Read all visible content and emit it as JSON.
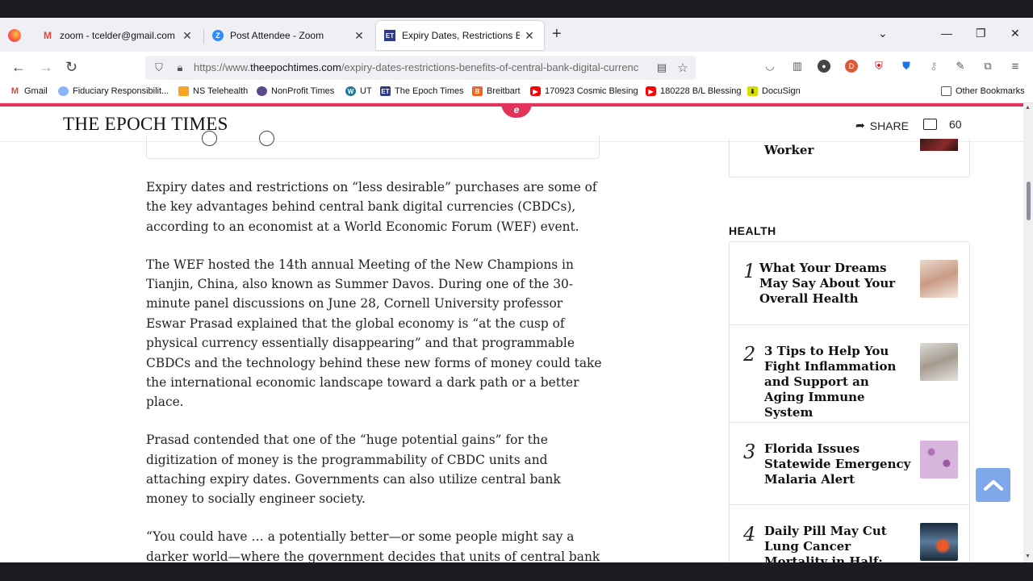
{
  "browser": {
    "tabs": [
      {
        "title": "zoom - tcelder@gmail.com - G",
        "icon": "gmail-icon",
        "active": false
      },
      {
        "title": "Post Attendee - Zoom",
        "icon": "zoom-icon",
        "active": false
      },
      {
        "title": "Expiry Dates, Restrictions Benef",
        "icon": "epoch-times-icon",
        "active": true
      }
    ],
    "new_tab": "+",
    "url_prefix": "https://www.",
    "url_domain": "theepochtimes.com",
    "url_path": "/expiry-dates-restrictions-benefits-of-central-bank-digital-currenc",
    "bookmarks": [
      {
        "label": "Gmail",
        "icon": "gmail-icon",
        "color": "#ea4335"
      },
      {
        "label": "Fiduciary Responsibilit...",
        "icon": "cloud-icon",
        "color": "#8ab4f8"
      },
      {
        "label": "NS Telehealth",
        "icon": "folder-icon",
        "color": "#f5a623"
      },
      {
        "label": "NonProfit Times",
        "icon": "globe-icon",
        "color": "#5b4a8a"
      },
      {
        "label": "UT",
        "icon": "wordpress-icon",
        "color": "#21759b"
      },
      {
        "label": "The Epoch Times",
        "icon": "epoch-times-icon",
        "color": "#2e3b8c"
      },
      {
        "label": "Breitbart",
        "icon": "breitbart-icon",
        "color": "#f26522"
      },
      {
        "label": "170923 Cosmic Blesing",
        "icon": "youtube-icon",
        "color": "#ff0000"
      },
      {
        "label": "180228 B/L Blessing",
        "icon": "youtube-icon",
        "color": "#ff0000"
      },
      {
        "label": "DocuSign",
        "icon": "docusign-icon",
        "color": "#d5e000"
      }
    ],
    "other_bookmarks": "Other Bookmarks"
  },
  "site": {
    "logo": "THE EPOCH TIMES",
    "share_label": "SHARE",
    "comment_count": "60",
    "accent_color": "#e3335b"
  },
  "article": {
    "paragraphs": [
      "Expiry dates and restrictions on “less desirable” purchases are some of the key advantages behind central bank digital currencies (CBDCs), according to an economist at a World Economic Forum (WEF) event.",
      "The WEF hosted the 14th annual Meeting of the New Champions in Tianjin, China, also known as Summer Davos. During one of the 30-minute panel discussions on June 28, Cornell University professor Eswar Prasad explained that the global economy is “at the cusp of physical currency essentially disappearing” and that programmable CBDCs and the technology behind these new forms of money could take the international economic landscape toward a dark path or a better place.",
      "Prasad contended that one of the “huge potential gains” for the digitization of money is the programmability of CBDC units and attaching expiry dates. Governments can also utilize central bank money to socially engineer society.",
      "“You could have … a potentially better—or some people might say a darker world—where the government decides that units of central bank money can be used to purchase some things, but not other things that it"
    ]
  },
  "sidebar": {
    "top_card_title": "Worker",
    "section_title": "HEALTH",
    "items": [
      {
        "num": "1",
        "title": "What Your Dreams May Say About Your Overall Health"
      },
      {
        "num": "2",
        "title": "3 Tips to Help You Fight Inflammation and Support an Aging Immune System"
      },
      {
        "num": "3",
        "title": "Florida Issues Statewide Emergency Malaria Alert"
      },
      {
        "num": "4",
        "title": "Daily Pill May Cut Lung Cancer Mortality in Half: Study"
      }
    ]
  }
}
